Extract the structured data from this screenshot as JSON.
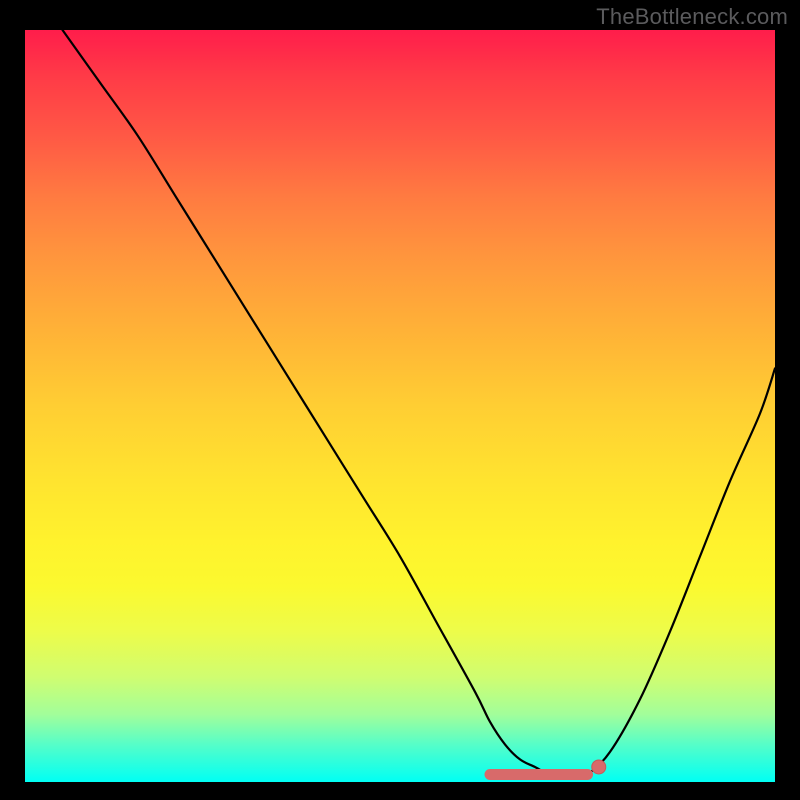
{
  "watermark": "TheBottleneck.com",
  "colors": {
    "frame": "#000000",
    "curve": "#000000",
    "marker_fill": "#d86a6a",
    "marker_stroke": "#c65a5a"
  },
  "chart_data": {
    "type": "line",
    "title": "",
    "xlabel": "",
    "ylabel": "",
    "xlim": [
      0,
      100
    ],
    "ylim": [
      0,
      100
    ],
    "grid": false,
    "series": [
      {
        "name": "curve",
        "x": [
          5,
          10,
          15,
          20,
          25,
          30,
          35,
          40,
          45,
          50,
          55,
          60,
          62,
          64,
          66,
          68,
          70,
          72,
          74,
          75,
          78,
          82,
          86,
          90,
          94,
          98,
          100
        ],
        "y": [
          100,
          93,
          86,
          78,
          70,
          62,
          54,
          46,
          38,
          30,
          21,
          12,
          8,
          5,
          3,
          2,
          1,
          1,
          1,
          1,
          4,
          11,
          20,
          30,
          40,
          49,
          55
        ]
      }
    ],
    "annotations": [
      {
        "name": "marker-band",
        "type": "flat-zone",
        "x_range": [
          62,
          75
        ],
        "y": 1
      },
      {
        "name": "marker-dot",
        "type": "point",
        "x": 76.5,
        "y": 2
      }
    ]
  }
}
